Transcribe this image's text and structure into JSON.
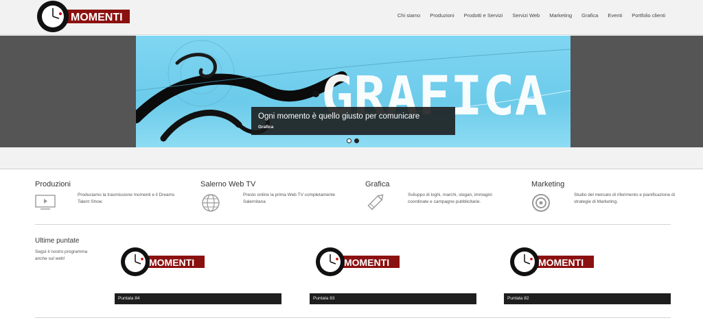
{
  "brand": {
    "name": "MOMENTI",
    "accent": "#8b1010"
  },
  "nav": [
    "Chi siamo",
    "Produzioni",
    "Prodotti e Servizi",
    "Servizi Web",
    "Marketing",
    "Grafica",
    "Eventi",
    "Portfolio clienti"
  ],
  "hero": {
    "title": "Ogni momento è quello giusto per comunicare",
    "subtitle": "Grafica",
    "image_text": "GRAFICA"
  },
  "services": [
    {
      "title": "Produzioni",
      "text": "Produciamo la trasmissione momenti e il Dreams Talent Show.",
      "icon": "tv-icon"
    },
    {
      "title": "Salerno Web TV",
      "text": "Presto online la prima Web TV completamente Salernitana",
      "icon": "globe-icon"
    },
    {
      "title": "Grafica",
      "text": "Sviluppo di loghi, marchi, slogan, immagini coordinate e campagne pubblicitarie.",
      "icon": "pencil-icon"
    },
    {
      "title": "Marketing",
      "text": "Studio del mercato di riferimento e pianificazione di strategie di Marketing.",
      "icon": "target-icon"
    }
  ],
  "latest": {
    "title": "Ultime puntate",
    "text": "Segui il nostro programma anche sul web!",
    "episodes": [
      {
        "label": "Puntata 84"
      },
      {
        "label": "Puntata 83"
      },
      {
        "label": "Puntata 82"
      }
    ]
  }
}
